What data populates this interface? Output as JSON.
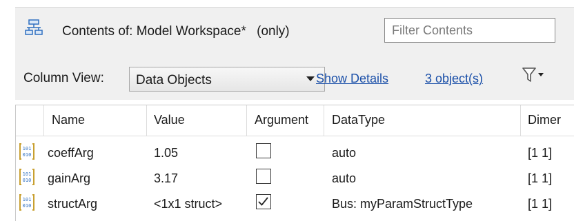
{
  "header": {
    "prefix": "Contents of:",
    "workspace": "Model Workspace*",
    "scope": "(only)",
    "filter_placeholder": "Filter Contents"
  },
  "toolbar": {
    "column_view_label": "Column View:",
    "column_view_value": "Data Objects",
    "show_details": "Show Details",
    "object_count": "3 object(s)"
  },
  "table": {
    "columns": [
      "Name",
      "Value",
      "Argument",
      "DataType",
      "Dimer"
    ],
    "rows": [
      {
        "name": "coeffArg",
        "value": "1.05",
        "argument": false,
        "datatype": "auto",
        "dims": "[1 1]"
      },
      {
        "name": "gainArg",
        "value": "3.17",
        "argument": false,
        "datatype": "auto",
        "dims": "[1 1]"
      },
      {
        "name": "structArg",
        "value": "<1x1 struct>",
        "argument": true,
        "datatype": "Bus: myParamStructType",
        "dims": "[1 1]"
      }
    ]
  },
  "icons": {
    "workspace": "model-workspace-icon",
    "filter": "filter-funnel-icon",
    "variable": "parameter-variable-icon"
  },
  "colors": {
    "link": "#1a4fa8",
    "panel_bg": "#f0f0f0",
    "icon_blue": "#2e6fc0",
    "icon_gold": "#c8a030"
  }
}
